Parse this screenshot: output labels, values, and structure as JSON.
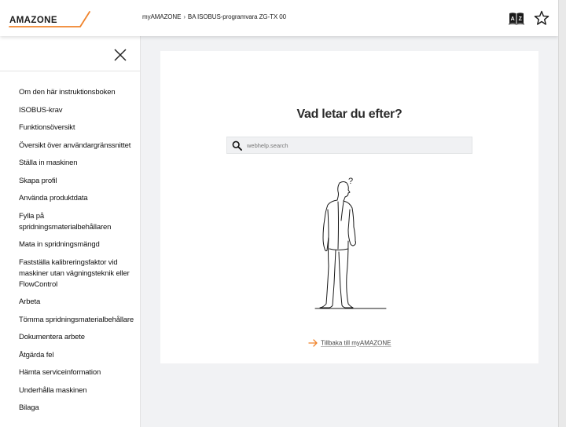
{
  "colors": {
    "accent": "#f0842c",
    "text": "#1f1f1f",
    "page_bg": "#f1f2f4"
  },
  "header": {
    "logo_text": "AMAZONE",
    "breadcrumb": [
      {
        "label": "myAMAZONE"
      },
      {
        "label": "BA ISOBUS-programvara ZG-TX 00"
      }
    ],
    "breadcrumb_separator": "›",
    "icons": {
      "dictionary": "dictionary-az-icon",
      "favorite": "star-icon"
    }
  },
  "sidebar": {
    "close_icon": "close-icon",
    "items": [
      "Om den här instruktionsboken",
      "ISOBUS-krav",
      "Funktionsöversikt",
      "Översikt över användargränssnittet",
      "Ställa in maskinen",
      "Skapa profil",
      "Använda produktdata",
      "Fylla på spridningsmaterialbehållaren",
      "Mata in spridningsmängd",
      "Fastställa kalibreringsfaktor vid maskiner utan vägningsteknik eller FlowControl",
      "Arbeta",
      "Tömma spridningsmaterialbehållare",
      "Dokumentera arbete",
      "Åtgärda fel",
      "Hämta serviceinformation",
      "Underhålla maskinen",
      "Bilaga"
    ]
  },
  "main": {
    "title": "Vad letar du efter?",
    "search": {
      "placeholder": "webhelp.search",
      "value": ""
    },
    "illustration_question": "?",
    "back_link": "Tillbaka till myAMAZONE"
  }
}
